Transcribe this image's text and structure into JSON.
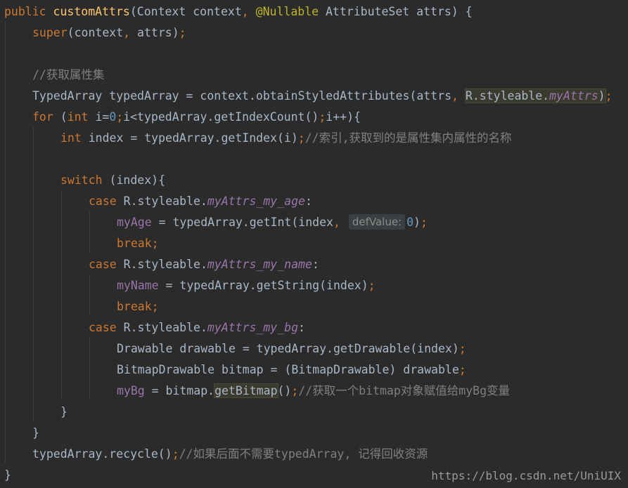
{
  "editor": {
    "l1": {
      "t1": "public ",
      "t2": "customAttrs",
      "t3": "(Context context",
      "t4": ", ",
      "t5": "@Nullable ",
      "t6": "AttributeSet attrs) {"
    },
    "l2": {
      "t1": "super",
      "t2": "(context",
      "t3": ", ",
      "t4": "attrs)",
      "t5": ";"
    },
    "l4": {
      "t1": "//获取属性集"
    },
    "l5": {
      "t1": "TypedArray typedArray = context.obtainStyledAttributes(attrs",
      "t2": ", ",
      "t3": "R.styleable.",
      "t4": "myAttrs",
      "t5": ")",
      "t6": ";"
    },
    "l6": {
      "t1": "for ",
      "t2": "(",
      "t3": "int ",
      "t4": "i=",
      "t5": "0",
      "t6": ";",
      "t7": "i<typedArray.getIndexCount()",
      "t8": ";",
      "t9": "i++){"
    },
    "l7": {
      "t1": "int ",
      "t2": "index = typedArray.getIndex(i)",
      "t3": ";",
      "t4": "//索引,获取到的是属性集内属性的名称"
    },
    "l9": {
      "t1": "switch ",
      "t2": "(index){"
    },
    "l10": {
      "t1": "case ",
      "t2": "R.styleable.",
      "t3": "myAttrs_my_age",
      "t4": ":"
    },
    "l11": {
      "t1": "myAge",
      "t2": " = typedArray.getInt(index",
      "t3": ", ",
      "t4": "defValue:",
      "t5": "0",
      "t6": ")",
      "t7": ";"
    },
    "l12": {
      "t1": "break;"
    },
    "l13": {
      "t1": "case ",
      "t2": "R.styleable.",
      "t3": "myAttrs_my_name",
      "t4": ":"
    },
    "l14": {
      "t1": "myName",
      "t2": " = typedArray.getString(index)",
      "t3": ";"
    },
    "l15": {
      "t1": "break;"
    },
    "l16": {
      "t1": "case ",
      "t2": "R.styleable.",
      "t3": "myAttrs_my_bg",
      "t4": ":"
    },
    "l17": {
      "t1": "Drawable drawable = typedArray.getDrawable(index)",
      "t2": ";"
    },
    "l18": {
      "t1": "BitmapDrawable bitmap = (BitmapDrawable) drawable",
      "t2": ";"
    },
    "l19": {
      "t1": "myBg",
      "t2": " = bitmap.",
      "t3": "getBitmap",
      "t4": "()",
      "t5": ";",
      "t6": "//获取一个bitmap对象赋值给myBg变量"
    },
    "l20": {
      "t1": "}"
    },
    "l21": {
      "t1": "}"
    },
    "l22": {
      "t1": "typedArray.recycle()",
      "t2": ";",
      "t3": "//如果后面不需要typedArray, 记得回收资源"
    },
    "l23": {
      "t1": "}"
    }
  },
  "watermark": "https://blog.csdn.net/UniUIX"
}
